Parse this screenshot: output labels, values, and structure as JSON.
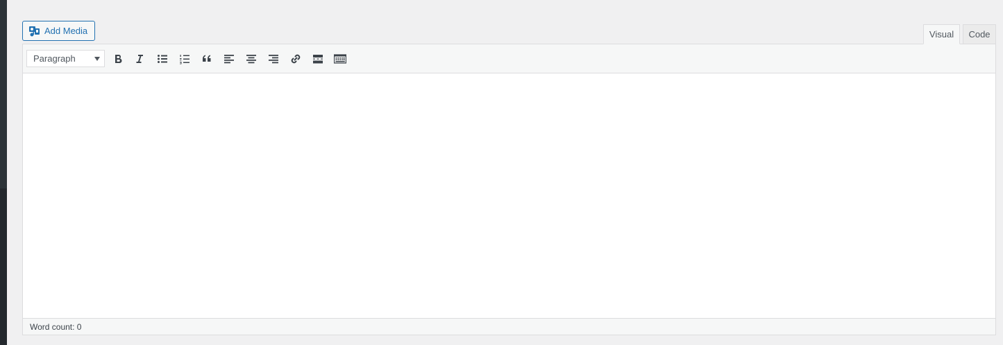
{
  "media": {
    "add_media_label": "Add Media"
  },
  "tabs": [
    {
      "label": "Visual"
    },
    {
      "label": "Code"
    }
  ],
  "toolbar": {
    "format_select": {
      "selected": "Paragraph"
    },
    "buttons": [
      {
        "icon": "bold-icon"
      },
      {
        "icon": "italic-icon"
      },
      {
        "icon": "bulleted-list-icon"
      },
      {
        "icon": "numbered-list-icon"
      },
      {
        "icon": "blockquote-icon"
      },
      {
        "icon": "align-left-icon"
      },
      {
        "icon": "align-center-icon"
      },
      {
        "icon": "align-right-icon"
      },
      {
        "icon": "link-icon"
      },
      {
        "icon": "read-more-icon"
      },
      {
        "icon": "toolbar-toggle-icon"
      }
    ]
  },
  "status": {
    "word_count_label": "Word count: 0"
  },
  "colors": {
    "accent": "#2271b1",
    "icon": "#3c434a",
    "border": "#dcdcde",
    "background": "#f0f0f1"
  }
}
